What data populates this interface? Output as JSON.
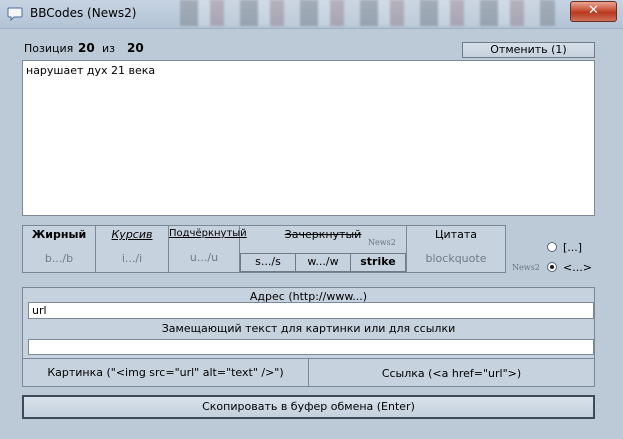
{
  "window": {
    "title": "BBCodes (News2)",
    "close_glyph": "✕"
  },
  "position": {
    "label": "Позиция",
    "current": "20",
    "of_label": "из",
    "total": "20"
  },
  "cancel_button": "Отменить (1)",
  "text": "нарушает дух 21 века",
  "codes": {
    "bold": {
      "label": "Жирный",
      "code": "b.../b"
    },
    "italic": {
      "label": "Курсив",
      "code": "i.../i"
    },
    "underline": {
      "label": "Подчёркнутый",
      "code": "u.../u"
    },
    "strike": {
      "label": "Зачеркнутый",
      "tag": "News2",
      "buttons": [
        "s.../s",
        "w.../w",
        "strike"
      ]
    },
    "quote": {
      "label": "Цитата",
      "code": "blockquote"
    }
  },
  "bracket_mode": {
    "tag": "News2",
    "options": [
      {
        "label": "[...]",
        "selected": false
      },
      {
        "label": "<...>",
        "selected": true
      }
    ]
  },
  "address": {
    "label": "Адрес (http://www...)",
    "value": "url"
  },
  "alt_text": {
    "label": "Замещающий текст для картинки или для ссылки",
    "value": ""
  },
  "image_button": "Картинка (\"<img src=\"url\" alt=\"text\" />\")",
  "link_button": "Ссылка (<a href=\"url\">)",
  "copy_button": "Скопировать в буфер обмена (Enter)",
  "icons": {
    "app": "speech-bubble-icon"
  }
}
